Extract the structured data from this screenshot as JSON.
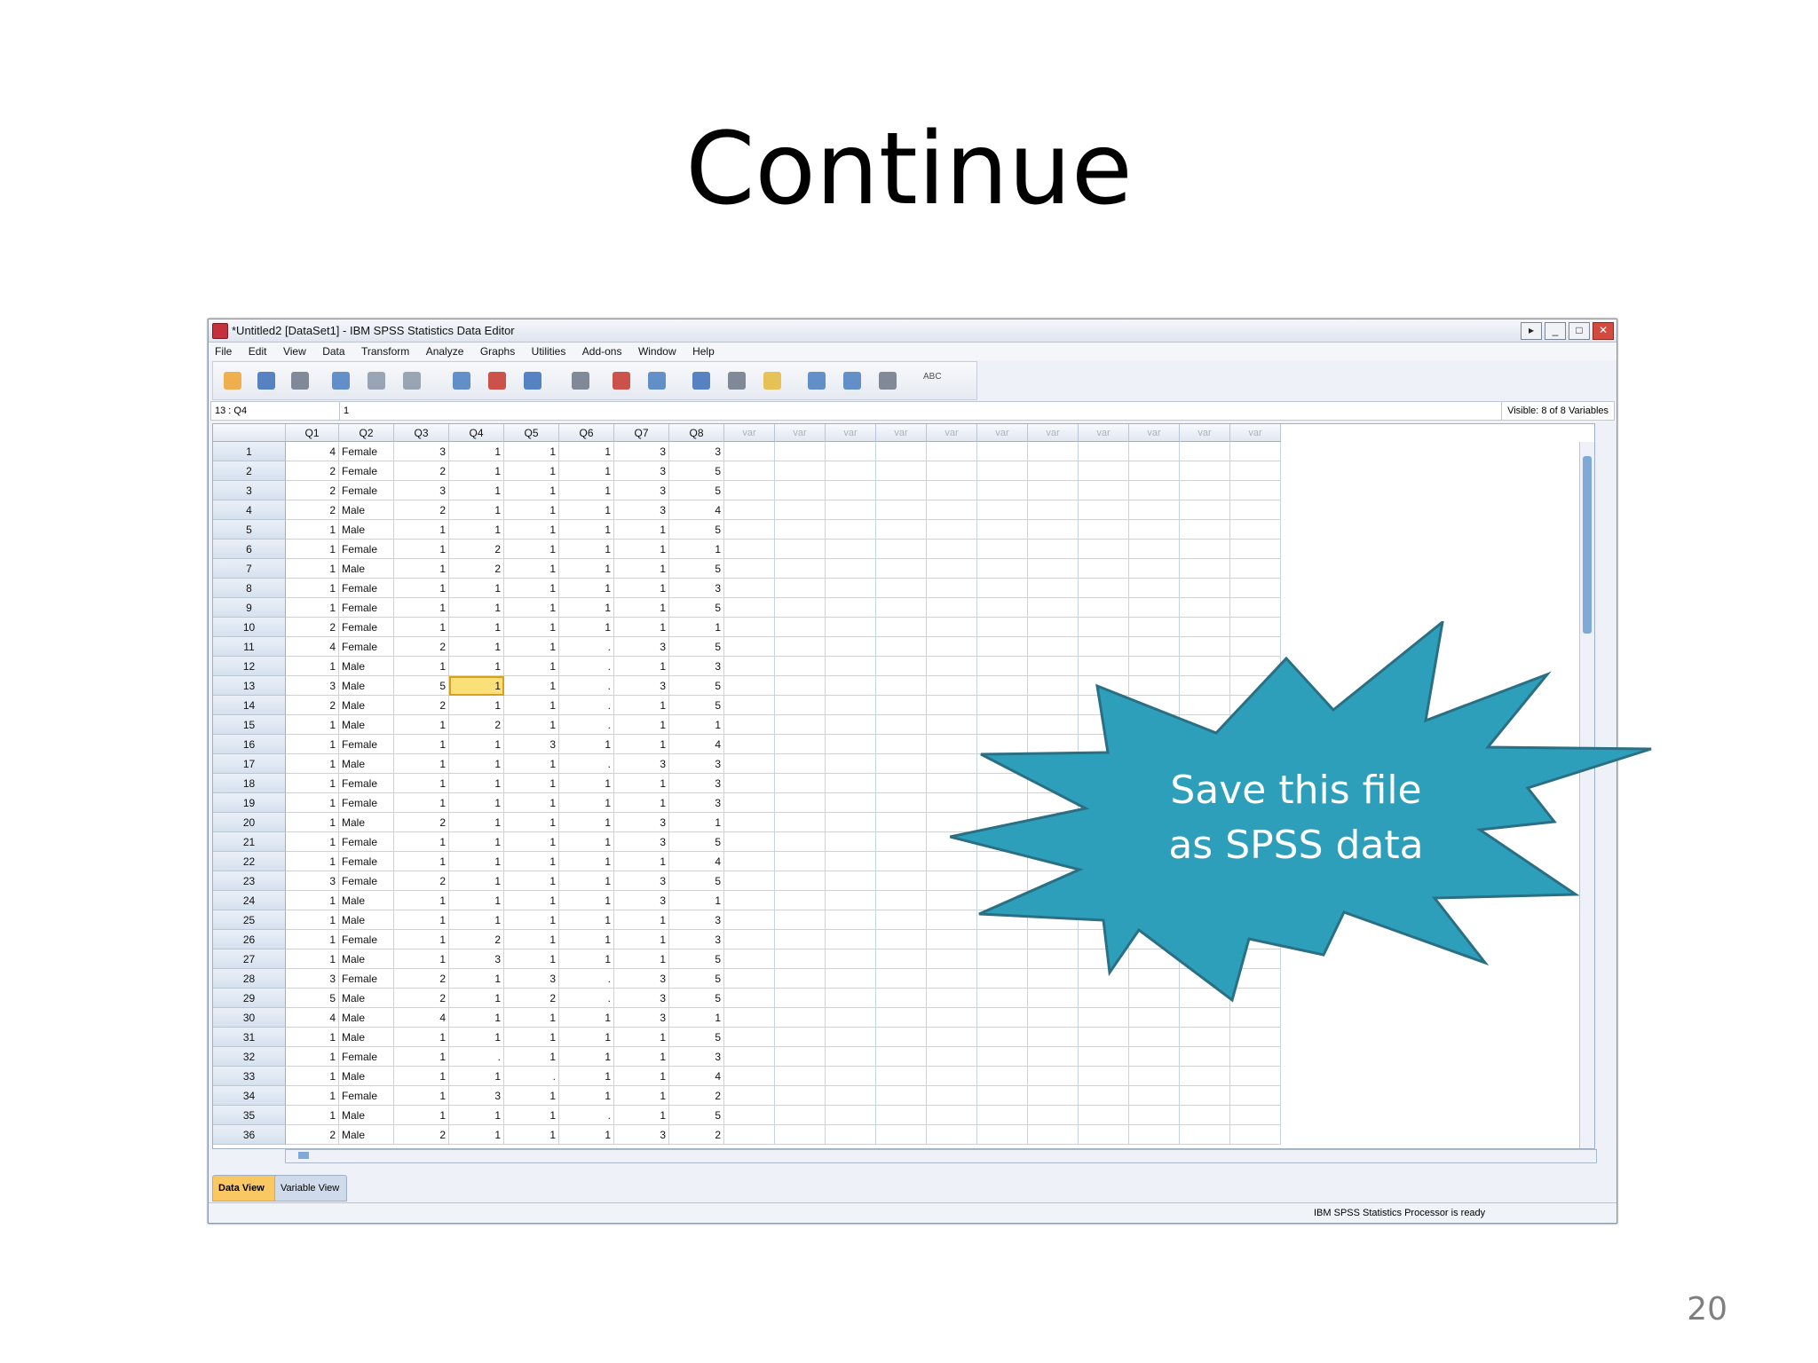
{
  "slide": {
    "title": "Continue",
    "page_number": "20"
  },
  "window": {
    "title": "*Untitled2 [DataSet1] - IBM SPSS Statistics Data Editor",
    "buttons": [
      "▸",
      "_",
      "□",
      "✕"
    ]
  },
  "menu": [
    "File",
    "Edit",
    "View",
    "Data",
    "Transform",
    "Analyze",
    "Graphs",
    "Utilities",
    "Add-ons",
    "Window",
    "Help"
  ],
  "toolbar": {
    "icons": [
      "open-icon",
      "save-icon",
      "print-icon",
      "recall-dialog-icon",
      "undo-icon",
      "redo-icon",
      "goto-case-icon",
      "goto-variable-icon",
      "variables-icon",
      "find-icon",
      "insert-cases-icon",
      "insert-variable-icon",
      "split-file-icon",
      "weight-cases-icon",
      "select-cases-icon",
      "value-labels-icon",
      "use-variable-sets-icon",
      "show-all-variables-icon",
      "spell-check-icon"
    ],
    "spell_label": "ABC"
  },
  "cell_editor": {
    "ref": "13 : Q4",
    "value": "1",
    "visible": "Visible: 8 of 8 Variables"
  },
  "columns": [
    "Q1",
    "Q2",
    "Q3",
    "Q4",
    "Q5",
    "Q6",
    "Q7",
    "Q8"
  ],
  "var_label": "var",
  "rows": [
    [
      "4",
      "Female",
      "3",
      "1",
      "1",
      "1",
      "3",
      "3"
    ],
    [
      "2",
      "Female",
      "2",
      "1",
      "1",
      "1",
      "3",
      "5"
    ],
    [
      "2",
      "Female",
      "3",
      "1",
      "1",
      "1",
      "3",
      "5"
    ],
    [
      "2",
      "Male",
      "2",
      "1",
      "1",
      "1",
      "3",
      "4"
    ],
    [
      "1",
      "Male",
      "1",
      "1",
      "1",
      "1",
      "1",
      "5"
    ],
    [
      "1",
      "Female",
      "1",
      "2",
      "1",
      "1",
      "1",
      "1"
    ],
    [
      "1",
      "Male",
      "1",
      "2",
      "1",
      "1",
      "1",
      "5"
    ],
    [
      "1",
      "Female",
      "1",
      "1",
      "1",
      "1",
      "1",
      "3"
    ],
    [
      "1",
      "Female",
      "1",
      "1",
      "1",
      "1",
      "1",
      "5"
    ],
    [
      "2",
      "Female",
      "1",
      "1",
      "1",
      "1",
      "1",
      "1"
    ],
    [
      "4",
      "Female",
      "2",
      "1",
      "1",
      ".",
      "3",
      "5"
    ],
    [
      "1",
      "Male",
      "1",
      "1",
      "1",
      ".",
      "1",
      "3"
    ],
    [
      "3",
      "Male",
      "5",
      "1",
      "1",
      ".",
      "3",
      "5"
    ],
    [
      "2",
      "Male",
      "2",
      "1",
      "1",
      ".",
      "1",
      "5"
    ],
    [
      "1",
      "Male",
      "1",
      "2",
      "1",
      ".",
      "1",
      "1"
    ],
    [
      "1",
      "Female",
      "1",
      "1",
      "3",
      "1",
      "1",
      "4"
    ],
    [
      "1",
      "Male",
      "1",
      "1",
      "1",
      ".",
      "3",
      "3"
    ],
    [
      "1",
      "Female",
      "1",
      "1",
      "1",
      "1",
      "1",
      "3"
    ],
    [
      "1",
      "Female",
      "1",
      "1",
      "1",
      "1",
      "1",
      "3"
    ],
    [
      "1",
      "Male",
      "2",
      "1",
      "1",
      "1",
      "3",
      "1"
    ],
    [
      "1",
      "Female",
      "1",
      "1",
      "1",
      "1",
      "3",
      "5"
    ],
    [
      "1",
      "Female",
      "1",
      "1",
      "1",
      "1",
      "1",
      "4"
    ],
    [
      "3",
      "Female",
      "2",
      "1",
      "1",
      "1",
      "3",
      "5"
    ],
    [
      "1",
      "Male",
      "1",
      "1",
      "1",
      "1",
      "3",
      "1"
    ],
    [
      "1",
      "Male",
      "1",
      "1",
      "1",
      "1",
      "1",
      "3"
    ],
    [
      "1",
      "Female",
      "1",
      "2",
      "1",
      "1",
      "1",
      "3"
    ],
    [
      "1",
      "Male",
      "1",
      "3",
      "1",
      "1",
      "1",
      "5"
    ],
    [
      "3",
      "Female",
      "2",
      "1",
      "3",
      ".",
      "3",
      "5"
    ],
    [
      "5",
      "Male",
      "2",
      "1",
      "2",
      ".",
      "3",
      "5"
    ],
    [
      "4",
      "Male",
      "4",
      "1",
      "1",
      "1",
      "3",
      "1"
    ],
    [
      "1",
      "Male",
      "1",
      "1",
      "1",
      "1",
      "1",
      "5"
    ],
    [
      "1",
      "Female",
      "1",
      ".",
      "1",
      "1",
      "1",
      "3"
    ],
    [
      "1",
      "Male",
      "1",
      "1",
      ".",
      "1",
      "1",
      "4"
    ],
    [
      "1",
      "Female",
      "1",
      "3",
      "1",
      "1",
      "1",
      "2"
    ],
    [
      "1",
      "Male",
      "1",
      "1",
      "1",
      ".",
      "1",
      "5"
    ],
    [
      "2",
      "Male",
      "2",
      "1",
      "1",
      "1",
      "3",
      "2"
    ]
  ],
  "selected": {
    "row": 13,
    "col": "Q4"
  },
  "tabs": {
    "data_view": "Data View",
    "variable_view": "Variable View"
  },
  "status": "IBM SPSS Statistics Processor is ready",
  "callout": {
    "line1": "Save this file",
    "line2": "as SPSS data",
    "color": "#2e9fba"
  }
}
